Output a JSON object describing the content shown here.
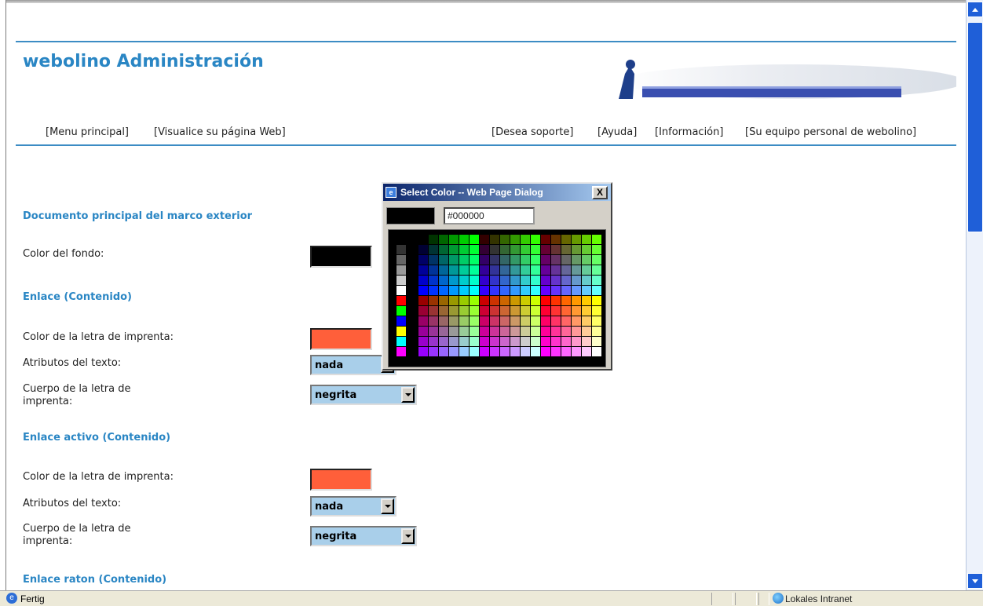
{
  "header": {
    "title": "webolino Administración",
    "logo_alt": "webolino"
  },
  "nav": {
    "left": [
      "[Menu principal]",
      "[Visualice su página Web]"
    ],
    "right": [
      "[Desea soporte]",
      "[Ayuda]",
      "[Información]",
      "[Su equipo personal de webolino]"
    ]
  },
  "sections": {
    "documento": {
      "heading": "Documento principal del marco exterior",
      "bg_label": "Color del fondo:",
      "bg_color": "#000000"
    },
    "enlace": {
      "heading": "Enlace (Contenido)",
      "color_label": "Color de la letra de imprenta:",
      "color": "#ff5f3a",
      "attr_label": "Atributos del texto:",
      "attr_value": "nada",
      "body_label_1": "Cuerpo de la letra de",
      "body_label_2": "imprenta:",
      "body_value": "negrita"
    },
    "enlace_activo": {
      "heading": "Enlace activo (Contenido)",
      "color_label": "Color de la letra de imprenta:",
      "color": "#ff5f3a",
      "attr_label": "Atributos del texto:",
      "attr_value": "nada",
      "body_label_1": "Cuerpo de la letra de",
      "body_label_2": "imprenta:",
      "body_value": "negrita"
    },
    "enlace_raton": {
      "heading": "Enlace raton (Contenido)"
    }
  },
  "dialog": {
    "title": "Select Color -- Web Page Dialog",
    "close": "X",
    "hex_value": "#000000",
    "preview_color": "#000000"
  },
  "statusbar": {
    "text": "Fertig",
    "zone": "Lokales Intranet"
  }
}
